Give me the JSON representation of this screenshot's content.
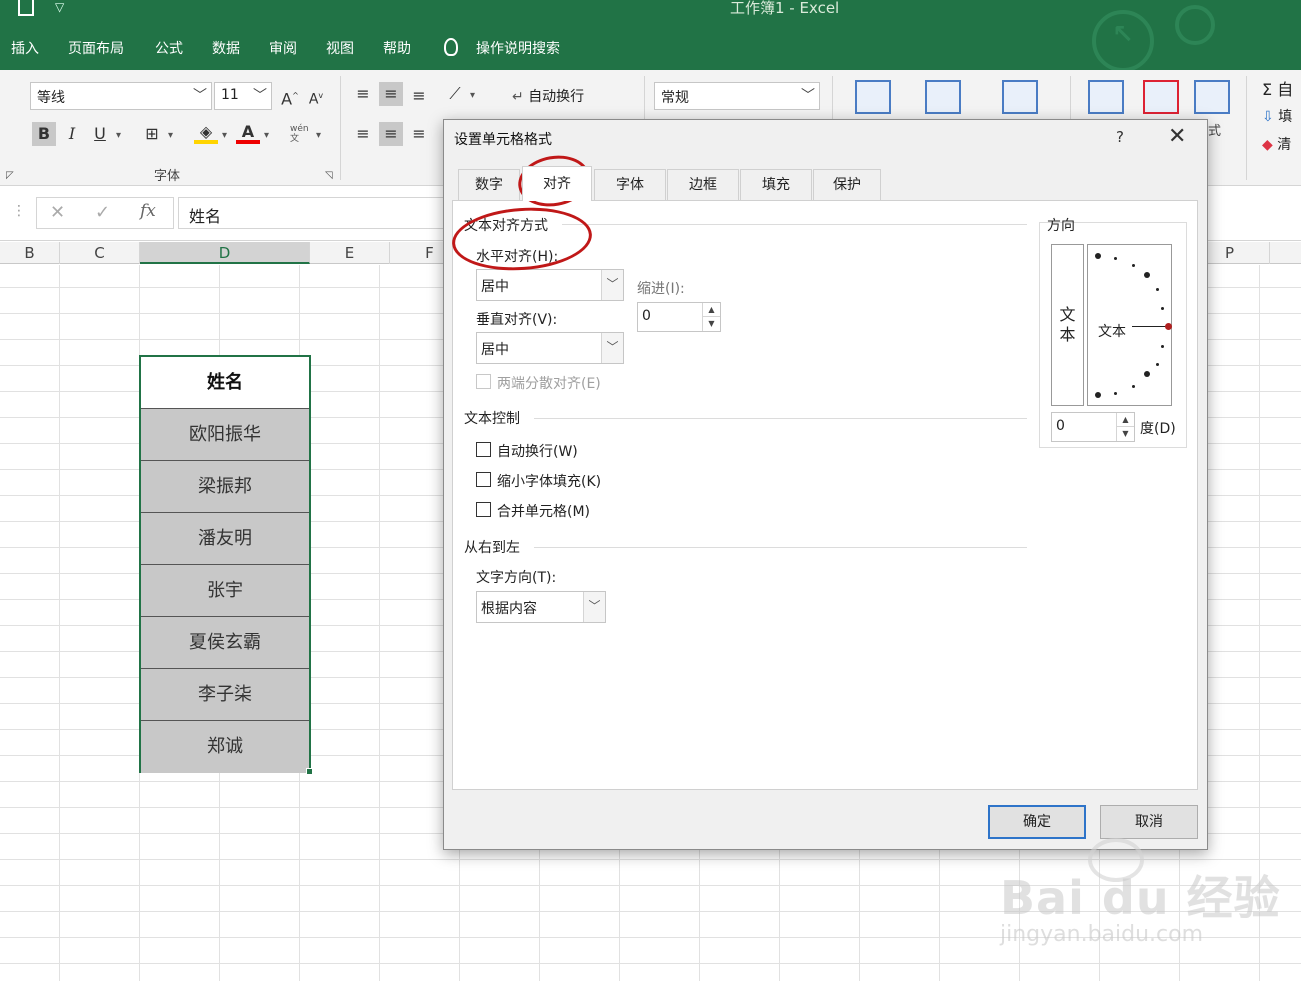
{
  "app": {
    "title": "工作簿1  -  Excel"
  },
  "menu": [
    "插入",
    "页面布局",
    "公式",
    "数据",
    "审阅",
    "视图",
    "帮助",
    "操作说明搜索"
  ],
  "ribbon": {
    "font_name": "等线",
    "font_size": "11",
    "grow_font": "A",
    "shrink_font": "A",
    "bold": "B",
    "italic": "I",
    "underline": "U",
    "phonetic": "wén\n文",
    "font_group_label": "字体",
    "wrap_text": "自动换行",
    "number_format": "常规",
    "cells_partial": "式",
    "autosum": "自",
    "fill": "填",
    "clear": "清"
  },
  "formula_bar": {
    "cancel": "✕",
    "enter": "✓",
    "fx": "fx",
    "value": "姓名"
  },
  "columns": [
    "B",
    "C",
    "D",
    "E",
    "F",
    "P"
  ],
  "table": {
    "header": "姓名",
    "rows": [
      "欧阳振华",
      "梁振邦",
      "潘友明",
      "张宇",
      "夏侯玄霸",
      "李子柒",
      "郑诚"
    ]
  },
  "dialog": {
    "title": "设置单元格格式",
    "help": "?",
    "close": "✕",
    "tabs": [
      "数字",
      "对齐",
      "字体",
      "边框",
      "填充",
      "保护"
    ],
    "active_tab": "对齐",
    "text_alignment": {
      "title": "文本对齐方式",
      "horizontal_label": "水平对齐(H):",
      "horizontal_value": "居中",
      "indent_label": "缩进(I):",
      "indent_value": "0",
      "vertical_label": "垂直对齐(V):",
      "vertical_value": "居中",
      "justify_distributed": "两端分散对齐(E)"
    },
    "text_control": {
      "title": "文本控制",
      "wrap": "自动换行(W)",
      "shrink": "缩小字体填充(K)",
      "merge": "合并单元格(M)"
    },
    "rtl": {
      "title": "从右到左",
      "direction_label": "文字方向(T):",
      "direction_value": "根据内容"
    },
    "orientation": {
      "title": "方向",
      "vertical_text": "文\n本",
      "dial_text": "文本",
      "degrees_value": "0",
      "degrees_label": "度(D)"
    },
    "ok": "确定",
    "cancel": "取消"
  },
  "watermark": {
    "brand": "Bai du 经验",
    "url": "jingyan.baidu.com"
  },
  "colors": {
    "excel_green": "#217346",
    "annotation_red": "#c01818"
  }
}
